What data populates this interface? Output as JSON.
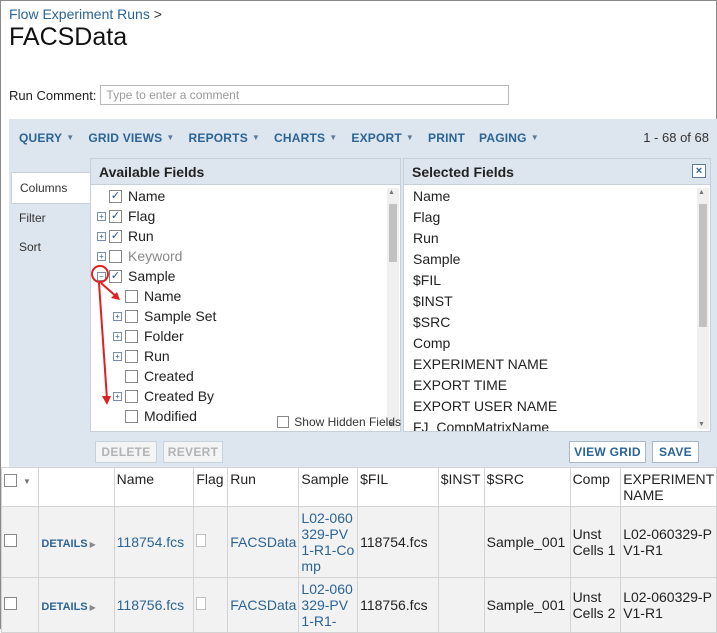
{
  "breadcrumb": {
    "link": "Flow Experiment Runs",
    "sep": ">"
  },
  "title": "FACSData",
  "run_comment": {
    "label": "Run Comment:",
    "placeholder": "Type to enter a comment"
  },
  "toolbar": {
    "buttons": [
      "QUERY",
      "GRID VIEWS",
      "REPORTS",
      "CHARTS",
      "EXPORT",
      "PRINT",
      "PAGING"
    ],
    "count": "1 - 68 of 68"
  },
  "customize": {
    "tabs": [
      "Columns",
      "Filter",
      "Sort"
    ],
    "available_title": "Available Fields",
    "selected_title": "Selected Fields",
    "close_glyph": "×",
    "available": [
      {
        "label": "Name",
        "checked": true,
        "expander": "",
        "indent": 0
      },
      {
        "label": "Flag",
        "checked": true,
        "expander": "+",
        "indent": 0
      },
      {
        "label": "Run",
        "checked": true,
        "expander": "+",
        "indent": 0
      },
      {
        "label": "Keyword",
        "checked": false,
        "expander": "+",
        "indent": 0,
        "dim": true
      },
      {
        "label": "Sample",
        "checked": true,
        "expander": "−",
        "indent": 0
      },
      {
        "label": "Name",
        "checked": false,
        "expander": "",
        "indent": 1
      },
      {
        "label": "Sample Set",
        "checked": false,
        "expander": "+",
        "indent": 1
      },
      {
        "label": "Folder",
        "checked": false,
        "expander": "+",
        "indent": 1
      },
      {
        "label": "Run",
        "checked": false,
        "expander": "+",
        "indent": 1
      },
      {
        "label": "Created",
        "checked": false,
        "expander": "",
        "indent": 1
      },
      {
        "label": "Created By",
        "checked": false,
        "expander": "+",
        "indent": 1
      },
      {
        "label": "Modified",
        "checked": false,
        "expander": "",
        "indent": 1
      }
    ],
    "selected": [
      "Name",
      "Flag",
      "Run",
      "Sample",
      "$FIL",
      "$INST",
      "$SRC",
      "Comp",
      "EXPERIMENT NAME",
      "EXPORT TIME",
      "EXPORT USER NAME",
      "FJ_CompMatrixName"
    ],
    "show_hidden_label": "Show Hidden Fields",
    "buttons": {
      "delete": "DELETE",
      "revert": "REVERT",
      "view_grid": "VIEW GRID",
      "save": "SAVE"
    }
  },
  "grid": {
    "headers": [
      "Name",
      "Flag",
      "Run",
      "Sample",
      "$FIL",
      "$INST",
      "$SRC",
      "Comp",
      "EXPERIMENT NAME"
    ],
    "rows": [
      {
        "details": "DETAILS",
        "name": "118754.fcs",
        "run": "FACSData",
        "sample": "L02-060329-PV1-R1-Comp",
        "fil": "118754.fcs",
        "inst": "",
        "src": "Sample_001",
        "comp": "Unst Cells 1",
        "experiment": "L02-060329-PV1-R1"
      },
      {
        "details": "DETAILS",
        "name": "118756.fcs",
        "run": "FACSData",
        "sample": "L02-060329-PV1-R1-",
        "fil": "118756.fcs",
        "inst": "",
        "src": "Sample_001",
        "comp": "Unst Cells 2",
        "experiment": "L02-060329-PV1-R1"
      }
    ]
  },
  "colors": {
    "accent": "#2a6496",
    "toolbar_bg": "#dde5ee",
    "annotation": "#e02020"
  }
}
